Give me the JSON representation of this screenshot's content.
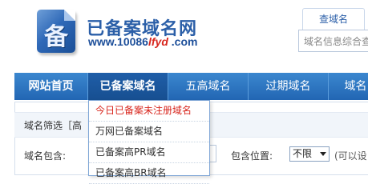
{
  "header": {
    "logo_glyph": "备",
    "title": "已备案域名网",
    "url_prefix": "www.10086",
    "url_highlight": "lfyd",
    "url_suffix": " .com",
    "search_tab": "查域名",
    "search_placeholder": "域名信息综合查"
  },
  "nav": {
    "items": [
      {
        "label": "网站首页"
      },
      {
        "label": "已备案域名"
      },
      {
        "label": "五高域名"
      },
      {
        "label": "过期域名"
      },
      {
        "label": "域名"
      }
    ]
  },
  "dropdown": {
    "items": [
      {
        "label": "今日已备案未注册域名"
      },
      {
        "label": "万网已备案域名"
      },
      {
        "label": "已备案高PR域名"
      },
      {
        "label": "已备案高BR域名"
      }
    ]
  },
  "filter": {
    "title": "域名筛选［高",
    "contains_label": "域名包含:",
    "position_label": "包含位置:",
    "position_value": "不限",
    "hint": "(可以设"
  },
  "colors": {
    "nav_bg": "#2a73c0",
    "brand_blue": "#2b5fa8",
    "accent_red": "#d8261d"
  }
}
